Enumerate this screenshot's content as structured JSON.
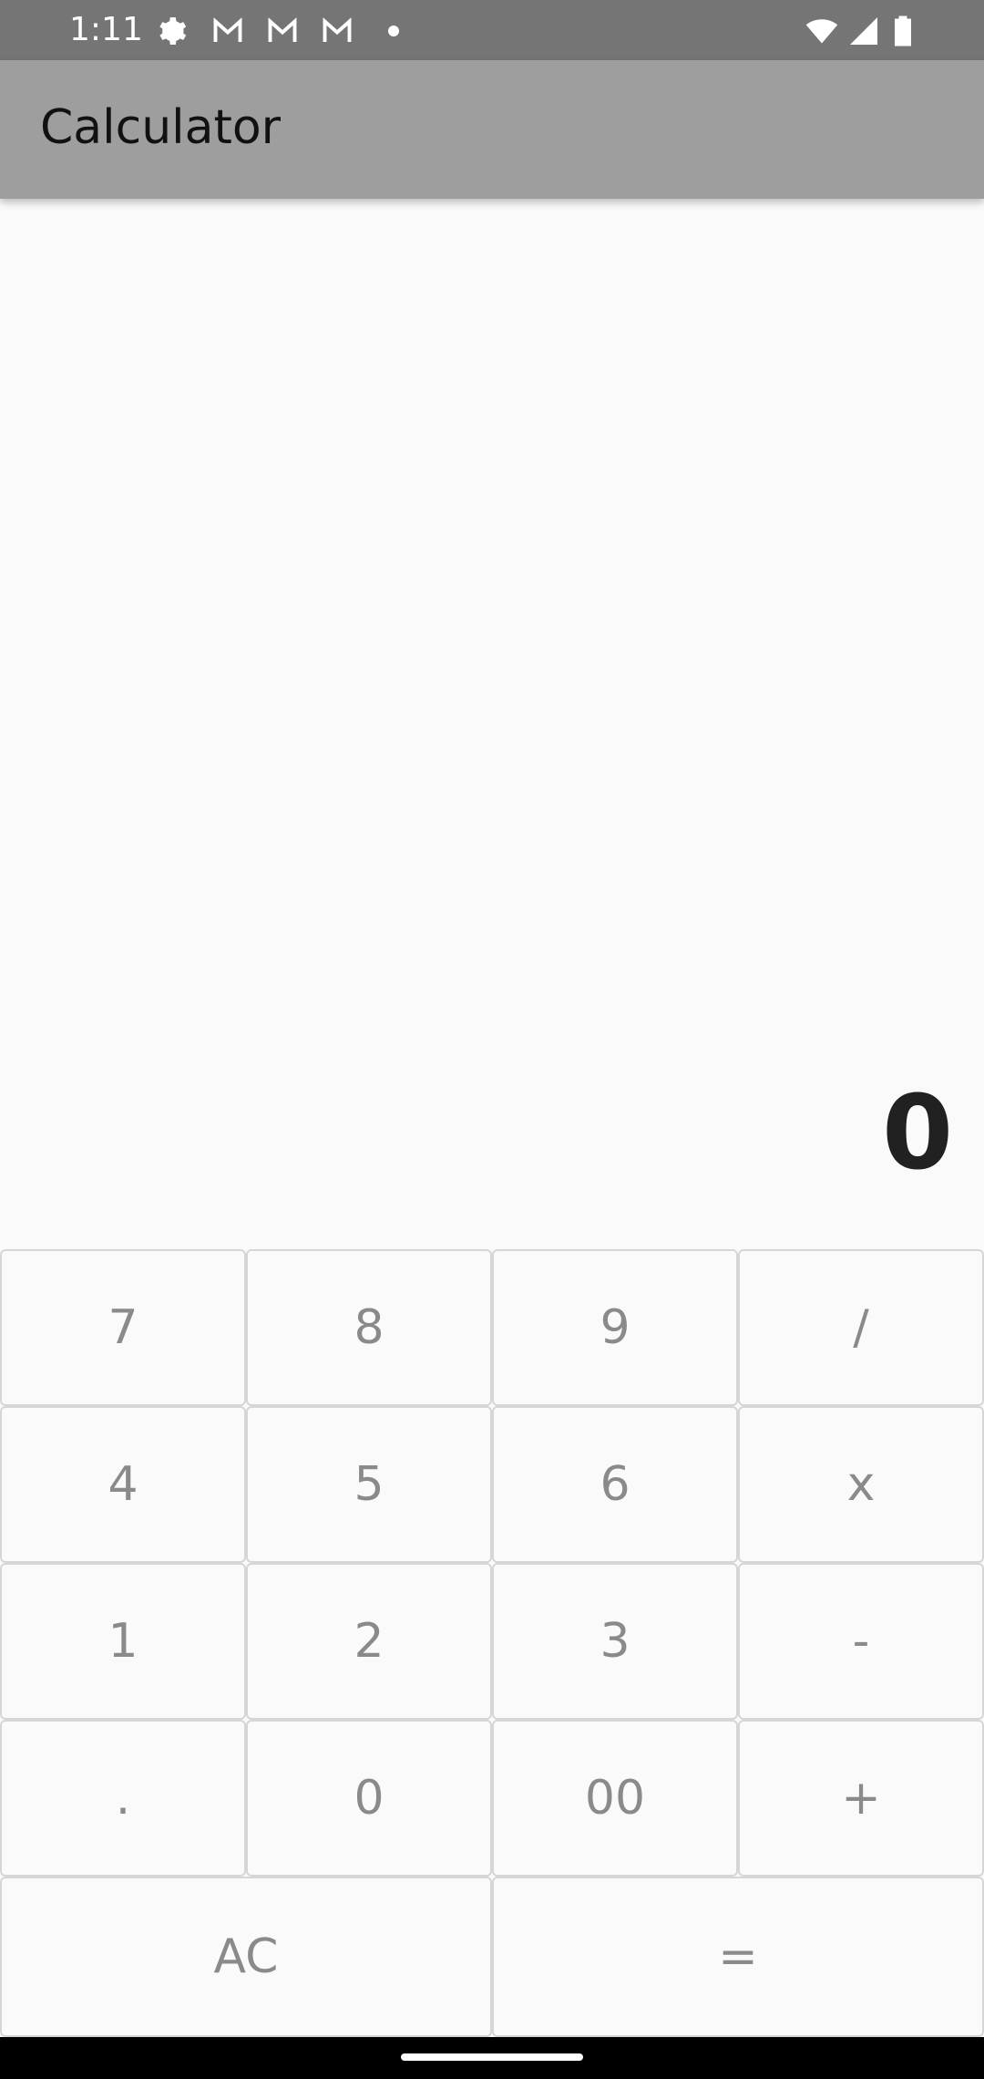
{
  "status_bar": {
    "time": "1:11",
    "icons": [
      "settings-icon",
      "gmail-icon",
      "gmail-icon",
      "gmail-icon",
      "dot-icon",
      "wifi-icon",
      "signal-icon",
      "battery-icon"
    ]
  },
  "app_bar": {
    "title": "Calculator"
  },
  "display": {
    "value": "0"
  },
  "keypad": {
    "row1": [
      "7",
      "8",
      "9",
      "/"
    ],
    "row2": [
      "4",
      "5",
      "6",
      "x"
    ],
    "row3": [
      "1",
      "2",
      "3",
      "-"
    ],
    "row4": [
      ".",
      "0",
      "00",
      "+"
    ],
    "row5": [
      "AC",
      "="
    ]
  },
  "colors": {
    "status_bar": "#757575",
    "app_bar": "#9e9e9e",
    "background": "#fafafa",
    "key_text": "#8a8a8a",
    "display_text": "#212121"
  }
}
